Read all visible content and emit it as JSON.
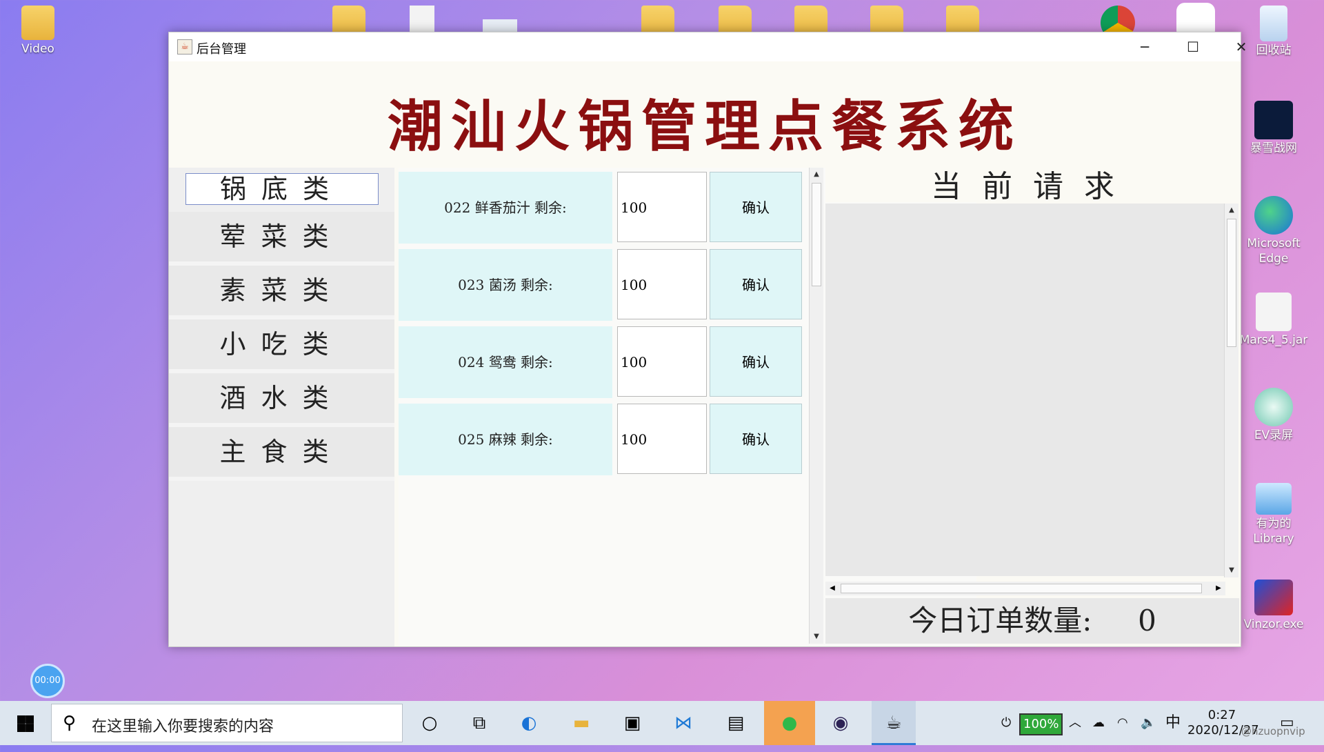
{
  "desktop": {
    "icons_left": [
      {
        "label": "Video",
        "icon": "folder-icon"
      }
    ],
    "icons_right": [
      {
        "label": "回收站",
        "icon": "recycle-bin-icon"
      },
      {
        "label": "暴雪战网",
        "icon": "battlenet-icon"
      },
      {
        "label": "Microsoft Edge",
        "icon": "edge-icon"
      },
      {
        "label": "Mars4_5.jar",
        "icon": "java-icon"
      },
      {
        "label": "EV录屏",
        "icon": "ev-recorder-icon"
      },
      {
        "label": "有为的 Library",
        "icon": "library-icon"
      },
      {
        "label": "Vinzor.exe",
        "icon": "vinzor-icon"
      }
    ],
    "record_badge": "00:00"
  },
  "window": {
    "title": "后台管理",
    "controls": {
      "minimize": "─",
      "maximize": "☐",
      "close": "✕"
    },
    "app_title": "潮汕火锅管理点餐系统",
    "categories": [
      "锅底类",
      "荤菜类",
      "素菜类",
      "小吃类",
      "酒水类",
      "主食类"
    ],
    "selected_category": "锅底类",
    "items": [
      {
        "label": "022  鲜香茄汁  剩余:",
        "qty": "100",
        "button": "确认"
      },
      {
        "label": "023  菌汤  剩余:",
        "qty": "100",
        "button": "确认"
      },
      {
        "label": "024  鸳鸯  剩余:",
        "qty": "100",
        "button": "确认"
      },
      {
        "label": "025  麻辣  剩余:",
        "qty": "100",
        "button": "确认"
      }
    ],
    "request_header": "当前请求",
    "order_count_label": "今日订单数量:",
    "order_count_value": "0"
  },
  "taskbar": {
    "search_placeholder": "在这里输入你要搜索的内容",
    "battery": "100%",
    "ime": "中",
    "time": "0:27",
    "date": "2020/12/27",
    "watermark": "@hzuopnvip"
  }
}
